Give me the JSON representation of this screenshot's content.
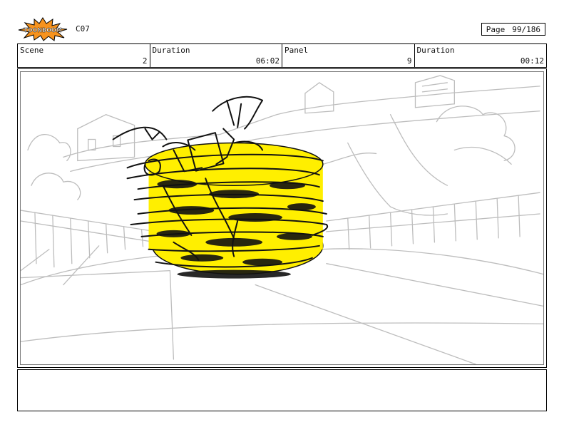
{
  "header": {
    "logo_text": "TOONBOOM",
    "project_code": "C07",
    "page_label": "Page",
    "page_value": "99/186"
  },
  "info": {
    "scene_label": "Scene",
    "scene_value": "2",
    "duration_label": "Duration",
    "duration_value": "06:02",
    "panel_label": "Panel",
    "panel_value": "9",
    "panel_duration_label": "Duration",
    "panel_duration_value": "00:12"
  },
  "colors": {
    "burst_fill": "#f7931e",
    "burst_stroke": "#000000",
    "spin_yellow": "#ffef00",
    "sketch_gray": "#bdbdbd",
    "ink": "#111111"
  },
  "icons": {
    "logo": "toonboom-burst-logo"
  }
}
